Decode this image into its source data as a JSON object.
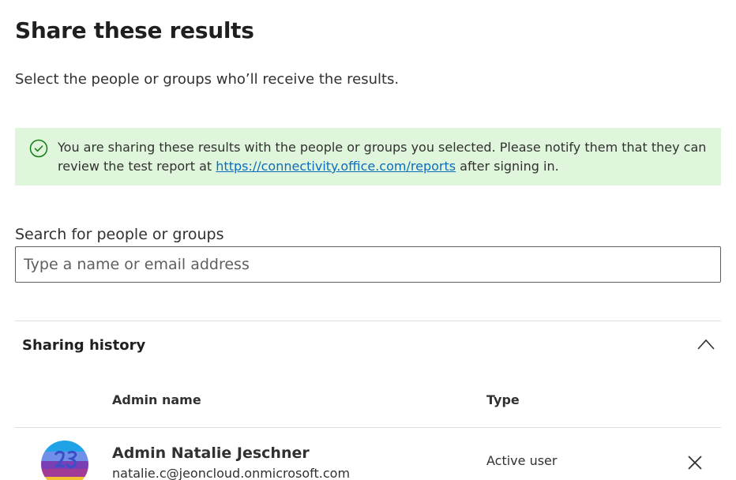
{
  "dialog": {
    "title": "Share these results",
    "subtitle": "Select the people or groups who’ll receive the results."
  },
  "banner": {
    "icon": "checkmark-circle-icon",
    "text_before": "You are sharing these results with the people or groups you selected. Please notify them that they can review the test report at ",
    "link_text": "https://connectivity.office.com/reports",
    "text_after": " after signing in.",
    "color": "#dff6dd"
  },
  "search": {
    "label": "Search for people or groups",
    "value": "",
    "placeholder": "Type a name or email address"
  },
  "history": {
    "title": "Sharing history",
    "columns": {
      "name": "Admin name",
      "type": "Type"
    },
    "rows": [
      {
        "name": "Admin Natalie Jeschner",
        "email": "natalie.c@jeoncloud.onmicrosoft.com",
        "type": "Active user",
        "avatar_icon": "user-avatar"
      }
    ]
  },
  "colors": {
    "link": "#0f6cbd",
    "success_icon": "#107c10",
    "text": "#323130"
  }
}
